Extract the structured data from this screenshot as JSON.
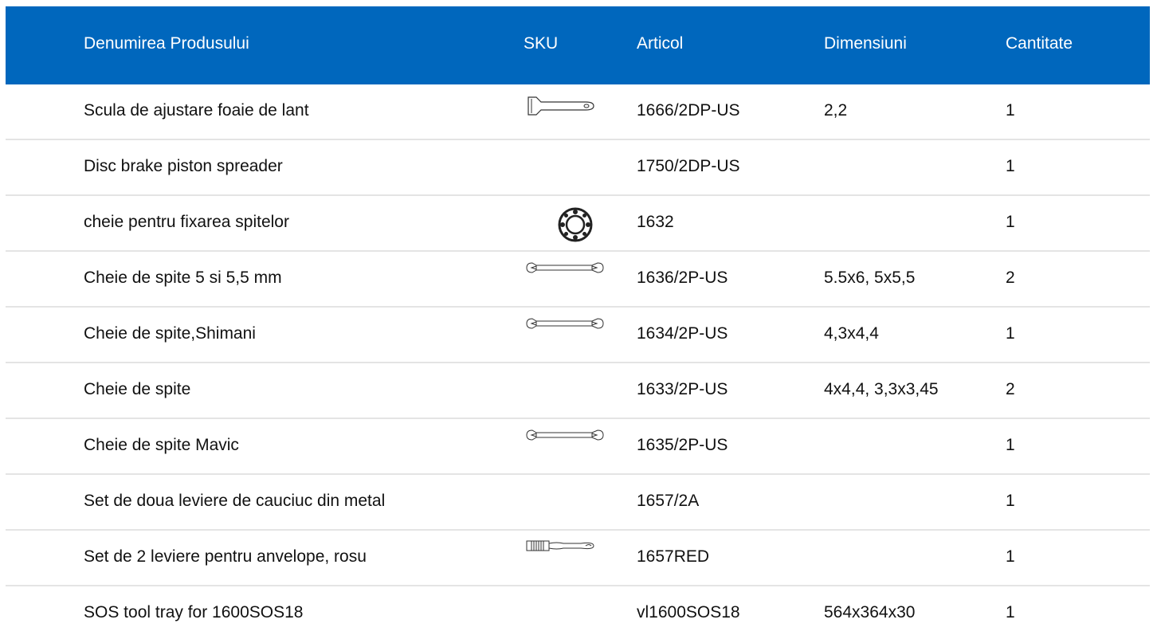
{
  "table": {
    "headers": {
      "name": "Denumirea Produsului",
      "sku": "SKU",
      "article": "Articol",
      "dimensions": "Dimensiuni",
      "quantity": "Cantitate"
    },
    "header_color": "#0067bd",
    "rows": [
      {
        "name": "Scula de ajustare foaie de lant",
        "sku_icon": "chain-tool-icon",
        "article": "1666/2DP-US",
        "dimensions": "2,2",
        "quantity": "1"
      },
      {
        "name": "Disc brake piston spreader",
        "sku_icon": "",
        "article": "1750/2DP-US",
        "dimensions": "",
        "quantity": "1"
      },
      {
        "name": "cheie pentru fixarea spitelor",
        "sku_icon": "spoke-wrench-round-icon",
        "article": "1632",
        "dimensions": "",
        "quantity": "1"
      },
      {
        "name": "Cheie de spite 5 si 5,5 mm",
        "sku_icon": "spoke-wrench-icon",
        "article": "1636/2P-US",
        "dimensions": "5.5x6, 5x5,5",
        "quantity": "2"
      },
      {
        "name": "Cheie de spite,Shimani",
        "sku_icon": "spoke-wrench-icon",
        "article": "1634/2P-US",
        "dimensions": "4,3x4,4",
        "quantity": "1"
      },
      {
        "name": "Cheie de spite",
        "sku_icon": "",
        "article": "1633/2P-US",
        "dimensions": "4x4,4, 3,3x3,45",
        "quantity": "2"
      },
      {
        "name": "Cheie de spite Mavic",
        "sku_icon": "spoke-wrench-icon",
        "article": "1635/2P-US",
        "dimensions": "",
        "quantity": "1"
      },
      {
        "name": "Set de doua leviere de cauciuc din metal",
        "sku_icon": "",
        "article": "1657/2A",
        "dimensions": "",
        "quantity": "1"
      },
      {
        "name": "Set de 2 leviere pentru anvelope, rosu",
        "sku_icon": "tire-lever-icon",
        "article": "1657RED",
        "dimensions": "",
        "quantity": "1"
      },
      {
        "name": "SOS tool tray for 1600SOS18",
        "sku_icon": "",
        "article": "vl1600SOS18",
        "dimensions": "564x364x30",
        "quantity": "1"
      }
    ]
  }
}
